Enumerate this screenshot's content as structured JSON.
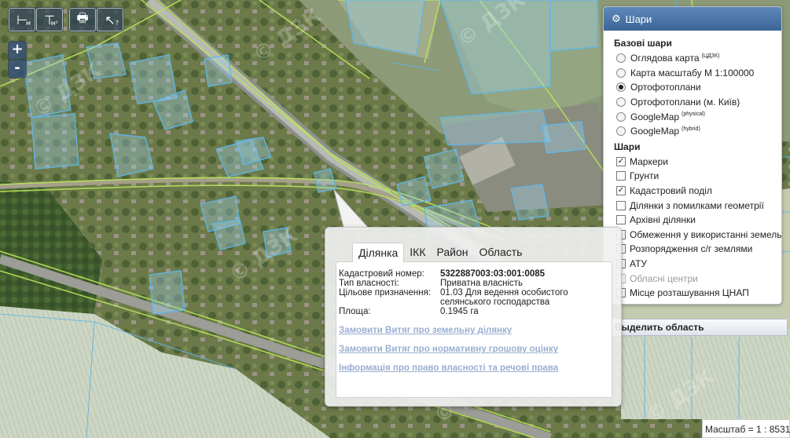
{
  "toolbar": {
    "buttons": [
      {
        "name": "measure-length-button",
        "glyph": "⊢",
        "sub": "м"
      },
      {
        "name": "measure-area-button",
        "glyph": "⊤",
        "sub": "м²"
      },
      {
        "name": "print-button",
        "glyph": "🖶",
        "sub": ""
      },
      {
        "name": "identify-button",
        "glyph": "↖",
        "sub": "?"
      }
    ],
    "zoom_in": "+",
    "zoom_out": "-"
  },
  "layers_panel": {
    "title": "Шари",
    "gear_icon": "gear-icon",
    "base_title": "Базові шари",
    "base_layers": [
      {
        "label": "Оглядова карта",
        "sup": "(ЦДЗК)",
        "selected": false
      },
      {
        "label": "Карта масштабу М 1:100000",
        "sup": "",
        "selected": false
      },
      {
        "label": "Ортофотоплани",
        "sup": "",
        "selected": true
      },
      {
        "label": "Ортофотоплани (м. Київ)",
        "sup": "",
        "selected": false
      },
      {
        "label": "GoogleMap",
        "sup": "(physical)",
        "selected": false
      },
      {
        "label": "GoogleMap",
        "sup": "(hybrid)",
        "selected": false
      }
    ],
    "overlay_title": "Шари",
    "overlay_layers": [
      {
        "label": "Маркери",
        "checked": true,
        "disabled": false
      },
      {
        "label": "Грунти",
        "checked": false,
        "disabled": false
      },
      {
        "label": "Кадастровий поділ",
        "checked": true,
        "disabled": false
      },
      {
        "label": "Ділянки з помилками геометрії",
        "checked": false,
        "disabled": false
      },
      {
        "label": "Архівні ділянки",
        "checked": false,
        "disabled": false
      },
      {
        "label": "Обмеження у використанні земель",
        "checked": false,
        "disabled": false
      },
      {
        "label": "Розпорядження с/г землями",
        "checked": false,
        "disabled": false
      },
      {
        "label": "АТУ",
        "checked": false,
        "disabled": false
      },
      {
        "label": "Обласні центри",
        "checked": false,
        "disabled": true
      },
      {
        "label": "Місце розташування ЦНАП",
        "checked": false,
        "disabled": false
      }
    ]
  },
  "select_area_label": "Выделить область",
  "popup": {
    "tabs": [
      "Ділянка",
      "ІКК",
      "Район",
      "Область"
    ],
    "active_tab": 0,
    "fields": [
      {
        "key": "Кадастровий номер:",
        "value": "5322887003:03:001:0085",
        "bold": true
      },
      {
        "key": "Тип власності:",
        "value": "Приватна власність",
        "bold": false
      },
      {
        "key": "Цільове призначення:",
        "value": "01.03 Для ведення особистого селянського господарства",
        "bold": false
      },
      {
        "key": "Площа:",
        "value": "0.1945 га",
        "bold": false
      }
    ],
    "links": [
      "Замовити Витяг про земельну ділянку",
      "Замовити Витяг про нормативну грошову оцінку",
      "Інформація про право власності та речові права"
    ]
  },
  "scale": "Масштаб = 1 : 8531",
  "colors": {
    "parcel_outline": "#5fb6e6",
    "parcel_fill": "#9fd3f0",
    "boundary_line": "#b9e35a",
    "field_light": "#c9d3b8",
    "accent": "#3c6698",
    "link": "#9aaed0"
  }
}
